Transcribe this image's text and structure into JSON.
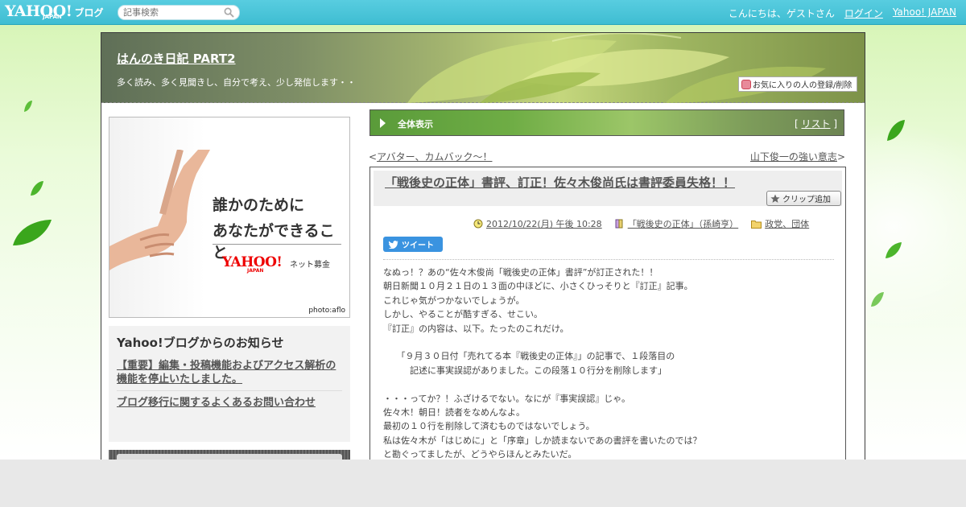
{
  "topbar": {
    "logo_main": "YAHOO!",
    "logo_sub": "ブログ",
    "logo_japan": "JAPAN",
    "search_placeholder": "記事検索",
    "greeting": "こんにちは、ゲストさん",
    "login": "ログイン",
    "yahoo_japan": "Yahoo! JAPAN"
  },
  "blog": {
    "title": "はんのき日記 PART2",
    "description": "多く読み、多く見聞きし、自分で考え、少し発信します・・",
    "fav_button": "お気に入りの人の登録/削除"
  },
  "ad": {
    "line1": "誰かのために",
    "line2": "あなたができること",
    "brand": "YAHOO!",
    "brand_sub": "JAPAN",
    "service": "ネット募金",
    "credit": "photo:aflo"
  },
  "notice": {
    "heading": "Yahoo!ブログからのお知らせ",
    "items": [
      "【重要】編集・投稿機能およびアクセス解析の機能を停止いたしました。",
      "ブログ移行に関するよくあるお問い合わせ"
    ]
  },
  "allbar": {
    "label": "全体表示",
    "list_open": "[ ",
    "list_link": "リスト",
    "list_close": " ]"
  },
  "nav": {
    "prev_mark": "<",
    "prev": "アバター、カムバック～！",
    "next": "山下俊一の強い意志",
    "next_mark": ">"
  },
  "post": {
    "title": "「戦後史の正体」書評、訂正！佐々木俊尚氏は書評委員失格！！",
    "clip_button": "クリップ追加",
    "date": "2012/10/22(月) 午後 10:28",
    "book": "「戦後史の正体」（孫崎亨）",
    "category": "政党、団体",
    "tweet": "ツイート",
    "body": [
      "なぬっ！？あの“佐々木俊尚「戦後史の正体」書評”が訂正された！！",
      "朝日新聞１０月２１日の１３面の中ほどに、小さくひっそりと『訂正』記事。",
      "これじゃ気がつかないでしょうが。",
      "しかし、やることが酷すぎる、せこい。",
      "『訂正』の内容は、以下。たったのこれだけ。",
      "",
      "　　「９月３０日付「売れてる本『戦後史の正体』」の記事で、１段落目の",
      "　　　記述に事実誤認がありました。この段落１０行分を削除します」",
      "",
      "・・・ってか？！ふざけるでない。なにが『事実誤認』じゃ。",
      "佐々木！朝日！読者をなめんなよ。",
      "最初の１０行を削除して済むものではないでしょう。",
      "私は佐々木が「はじめに」と「序章」しか読まないであの書評を書いたのでは？",
      "と勘ぐってましたが、どうやらほんとみたいだ。"
    ]
  },
  "colors": {
    "topbar": "#46c3d8",
    "tweet": "#3a93e0",
    "ad_brand": "#e00000"
  }
}
